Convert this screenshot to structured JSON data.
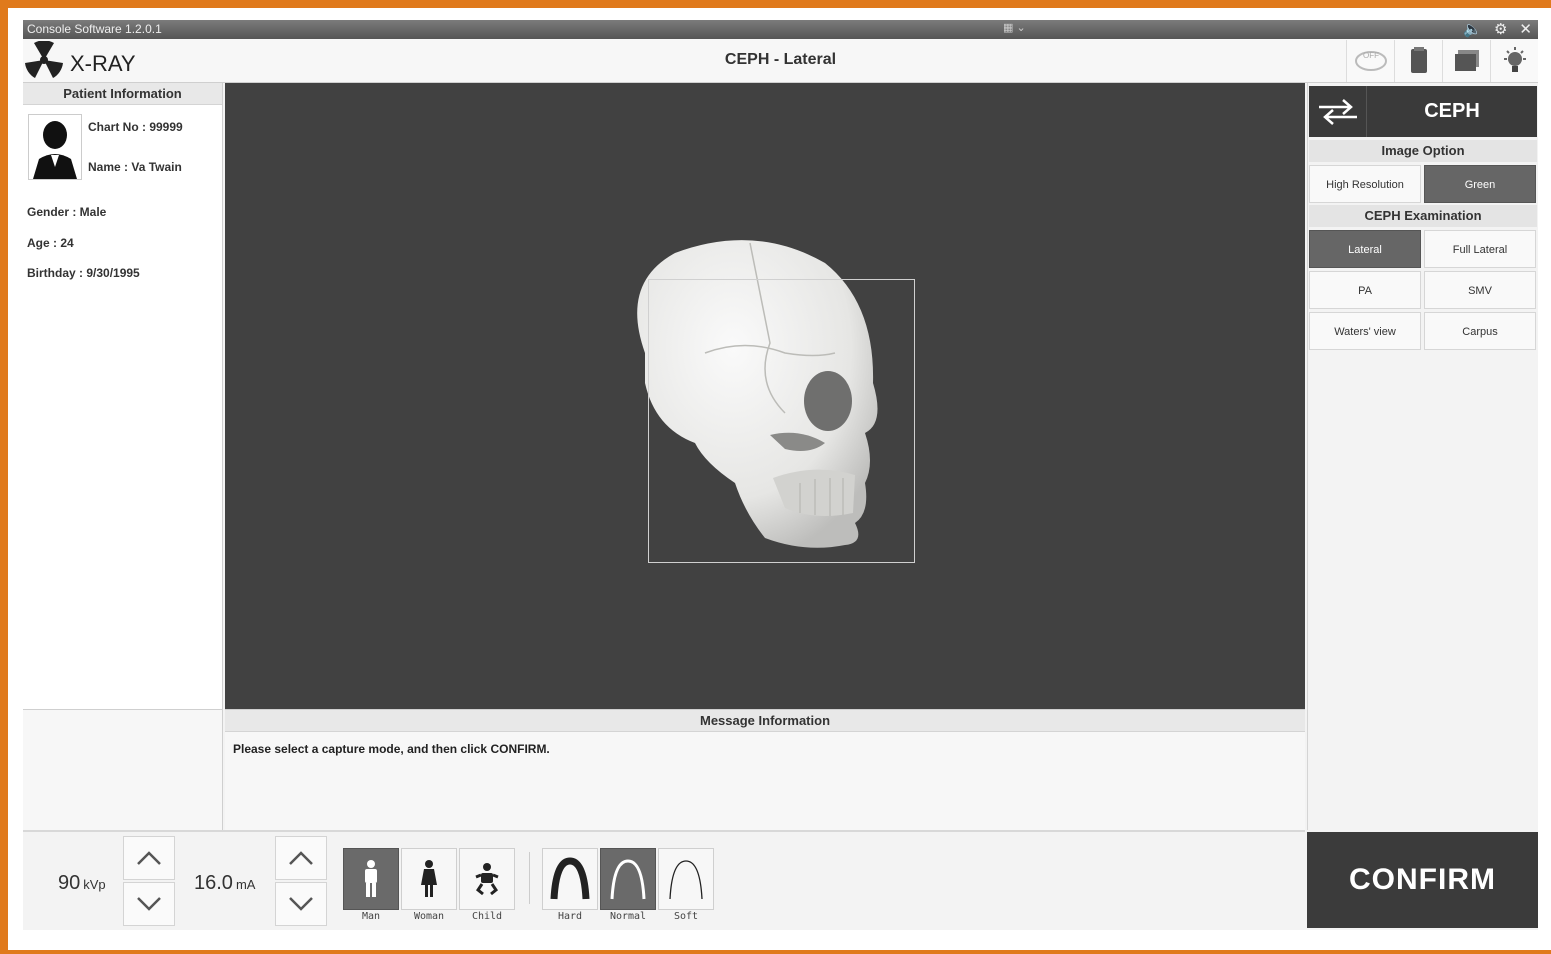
{
  "window": {
    "title": "Console Software 1.2.0.1",
    "controls": [
      "speaker-icon",
      "gear-icon",
      "close-icon"
    ]
  },
  "header": {
    "app_name": "X-RAY",
    "page_title": "CEPH - Lateral",
    "toolbar_icons": [
      "off-toggle-icon",
      "sensor-icon",
      "cassette-icon",
      "lamp-icon"
    ]
  },
  "patient": {
    "section_title": "Patient Information",
    "chart_no": "Chart No : 99999",
    "name": "Name : Va Twain",
    "gender": "Gender : Male",
    "age": "Age : 24",
    "birthday": "Birthday : 9/30/1995"
  },
  "message": {
    "section_title": "Message Information",
    "text": "Please select a capture mode, and then click CONFIRM."
  },
  "right_panel": {
    "mode_label": "CEPH",
    "image_option": {
      "title": "Image Option",
      "options": [
        {
          "label": "High Resolution",
          "active": false
        },
        {
          "label": "Green",
          "active": true
        }
      ]
    },
    "ceph_examination": {
      "title": "CEPH Examination",
      "options": [
        {
          "label": "Lateral",
          "active": true
        },
        {
          "label": "Full Lateral",
          "active": false
        },
        {
          "label": "PA",
          "active": false
        },
        {
          "label": "SMV",
          "active": false
        },
        {
          "label": "Waters' view",
          "active": false
        },
        {
          "label": "Carpus",
          "active": false
        }
      ]
    }
  },
  "exposure": {
    "kvp_value": "90",
    "kvp_unit": "kVp",
    "ma_value": "16.0",
    "ma_unit": "mA"
  },
  "patient_type": [
    {
      "label": "Man",
      "icon": "man-icon",
      "active": true
    },
    {
      "label": "Woman",
      "icon": "woman-icon",
      "active": false
    },
    {
      "label": "Child",
      "icon": "child-icon",
      "active": false
    }
  ],
  "arch_type": [
    {
      "label": "Hard",
      "icon": "hard-arch-icon",
      "active": false
    },
    {
      "label": "Normal",
      "icon": "normal-arch-icon",
      "active": true
    },
    {
      "label": "Soft",
      "icon": "soft-arch-icon",
      "active": false
    }
  ],
  "confirm_label": "CONFIRM",
  "colors": {
    "frame_border": "#e07a1c",
    "viewer_bg": "#414141",
    "active_button": "#666666",
    "confirm_bg": "#3b3b3b"
  }
}
